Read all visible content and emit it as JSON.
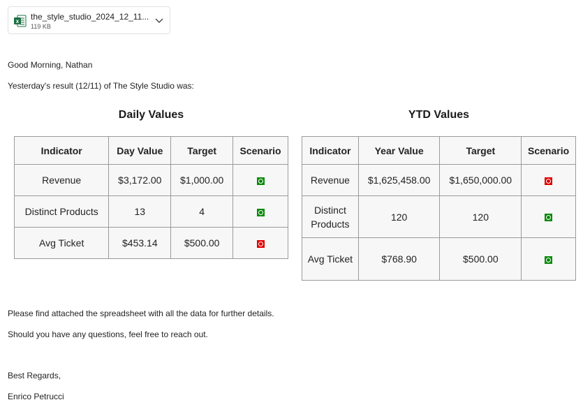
{
  "attachment": {
    "file_name": "the_style_studio_2024_12_11...",
    "file_size": "119 KB",
    "icon": "excel-file-icon",
    "icon_color": "#1d7044"
  },
  "email": {
    "greeting": "Good Morning, Nathan",
    "intro": "Yesterday's result (12/11) of The Style Studio was:",
    "body_line1": "Please find attached the spreadsheet with all the data for further details.",
    "body_line2": "Should you have any questions, feel free to reach out.",
    "closing": "Best Regards,",
    "signature": "Enrico Petrucci"
  },
  "status_colors": {
    "good": "#0a8a0a",
    "bad": "#e00000"
  },
  "daily": {
    "title": "Daily Values",
    "headers": [
      "Indicator",
      "Day Value",
      "Target",
      "Scenario"
    ],
    "rows": [
      {
        "indicator": "Revenue",
        "value": "$3,172.00",
        "target": "$1,000.00",
        "scenario": "good"
      },
      {
        "indicator": "Distinct Products",
        "value": "13",
        "target": "4",
        "scenario": "good"
      },
      {
        "indicator": "Avg Ticket",
        "value": "$453.14",
        "target": "$500.00",
        "scenario": "bad"
      }
    ]
  },
  "ytd": {
    "title": "YTD Values",
    "headers": [
      "Indicator",
      "Year Value",
      "Target",
      "Scenario"
    ],
    "rows": [
      {
        "indicator": "Revenue",
        "value": "$1,625,458.00",
        "target": "$1,650,000.00",
        "scenario": "bad"
      },
      {
        "indicator": "Distinct Products",
        "value": "120",
        "target": "120",
        "scenario": "good"
      },
      {
        "indicator": "Avg Ticket",
        "value": "$768.90",
        "target": "$500.00",
        "scenario": "good"
      }
    ]
  }
}
